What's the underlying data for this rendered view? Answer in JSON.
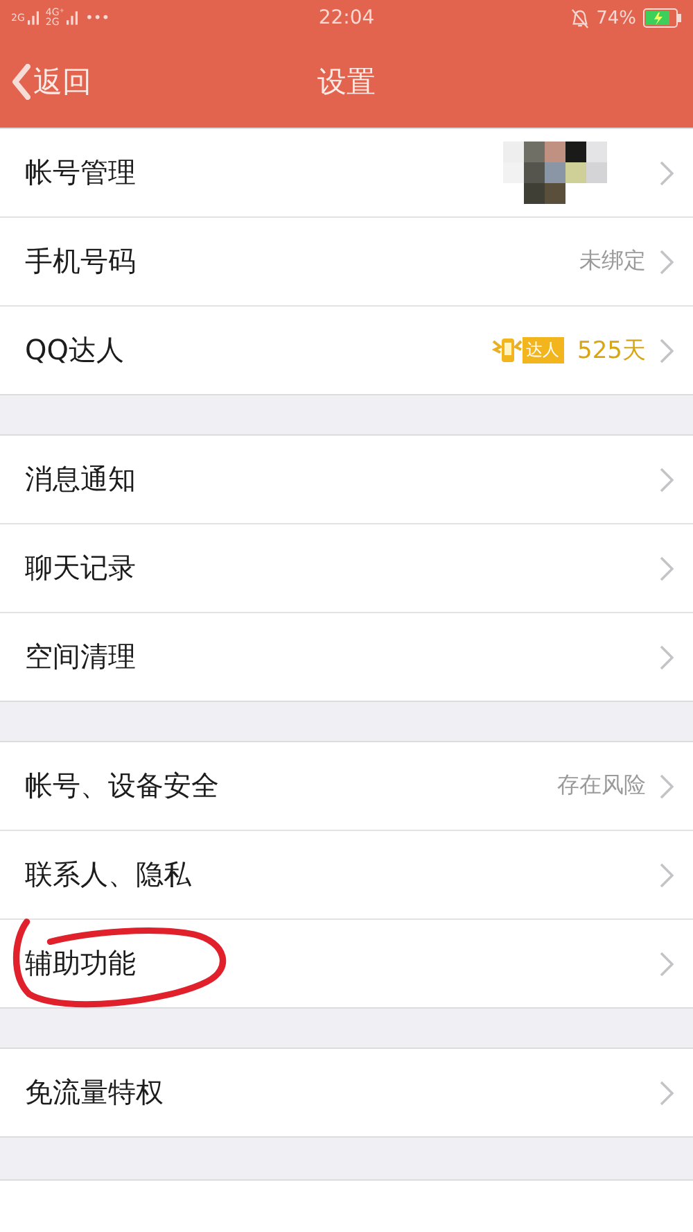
{
  "status_bar": {
    "networks": [
      {
        "label": "2G"
      },
      {
        "label": "4G⁺",
        "sub": "2G"
      }
    ],
    "more": "•••",
    "time": "22:04",
    "battery": "74%"
  },
  "header": {
    "back": "返回",
    "title": "设置"
  },
  "groups": [
    {
      "rows": [
        {
          "kind": "avatar",
          "label": "帐号管理",
          "circled": false
        },
        {
          "kind": "value",
          "label": "手机号码",
          "value": "未绑定",
          "circled": false
        },
        {
          "kind": "badge",
          "label": "QQ达人",
          "badge": "达人",
          "value": "525天",
          "circled": false
        }
      ]
    },
    {
      "rows": [
        {
          "kind": "plain",
          "label": "消息通知",
          "circled": false
        },
        {
          "kind": "plain",
          "label": "聊天记录",
          "circled": false
        },
        {
          "kind": "plain",
          "label": "空间清理",
          "circled": false
        }
      ]
    },
    {
      "rows": [
        {
          "kind": "value",
          "label": "帐号、设备安全",
          "value": "存在风险",
          "circled": false
        },
        {
          "kind": "plain",
          "label": "联系人、隐私",
          "circled": false
        },
        {
          "kind": "plain",
          "label": "辅助功能",
          "circled": true
        }
      ]
    },
    {
      "rows": [
        {
          "kind": "plain",
          "label": "免流量特权",
          "circled": false
        }
      ]
    }
  ]
}
